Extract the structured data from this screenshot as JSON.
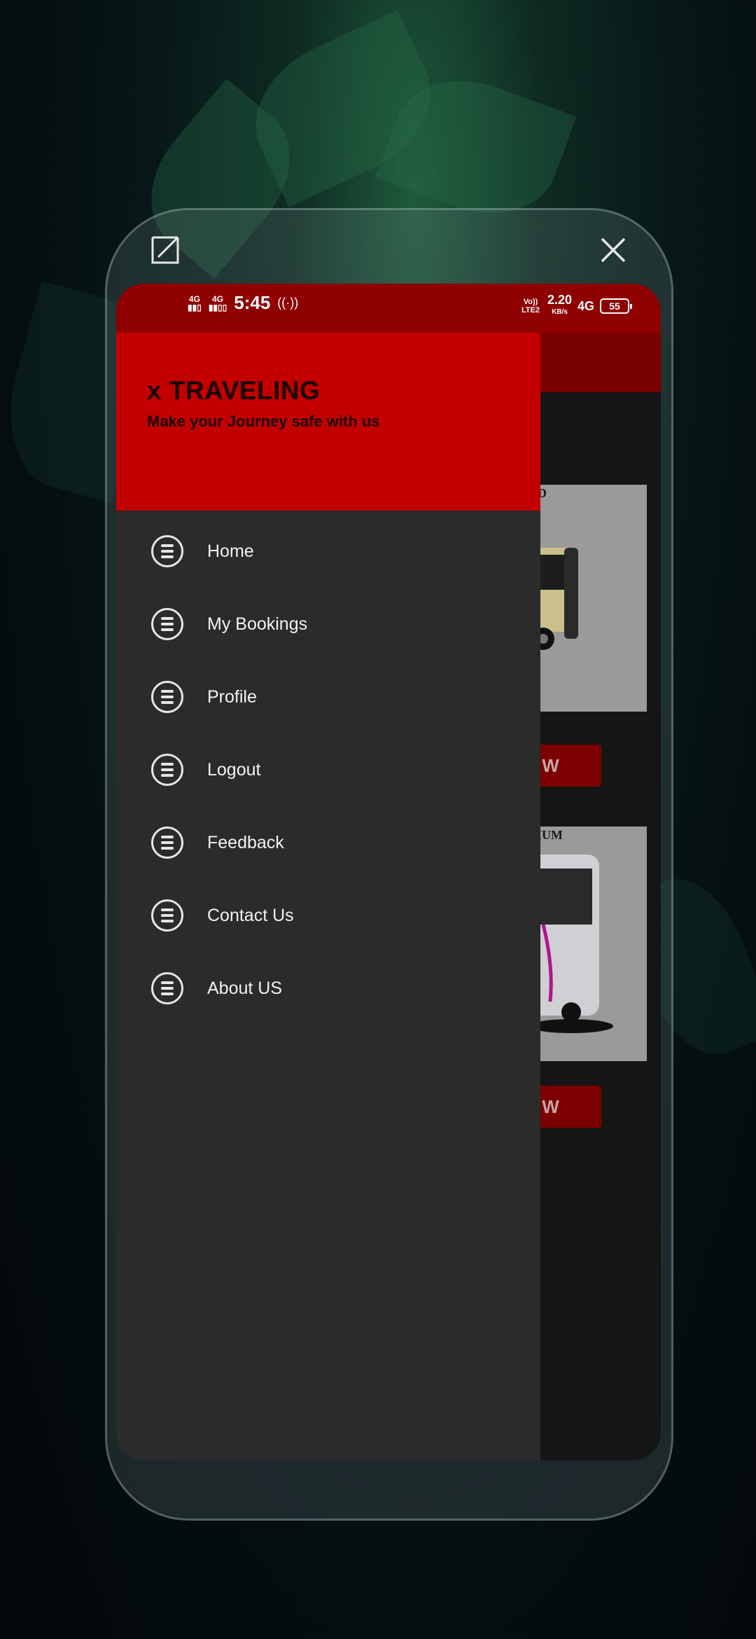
{
  "status_bar": {
    "time": "5:45",
    "sim1": "4G",
    "sim2": "4G",
    "volte": "Vo)) LTE2",
    "speed_value": "2.20",
    "speed_unit": "KB/s",
    "net_type": "4G",
    "battery": "55"
  },
  "drawer": {
    "title": "x TRAVELING",
    "subtitle": "Make your Journey safe with us",
    "items": [
      {
        "label": "Home",
        "icon": "menu-circle-icon"
      },
      {
        "label": "My Bookings",
        "icon": "menu-circle-icon"
      },
      {
        "label": "Profile",
        "icon": "menu-circle-icon"
      },
      {
        "label": "Logout",
        "icon": "menu-circle-icon"
      },
      {
        "label": "Feedback",
        "icon": "menu-circle-icon"
      },
      {
        "label": "Contact Us",
        "icon": "menu-circle-icon"
      },
      {
        "label": "About US",
        "icon": "menu-circle-icon"
      }
    ]
  },
  "background_cards": [
    {
      "title": "OD",
      "button": "OW"
    },
    {
      "title": "NIUM",
      "button": "OW"
    }
  ],
  "colors": {
    "drawer_header": "#c30000",
    "status_bar": "#8f0000",
    "drawer_bg": "#2b2b2b"
  }
}
